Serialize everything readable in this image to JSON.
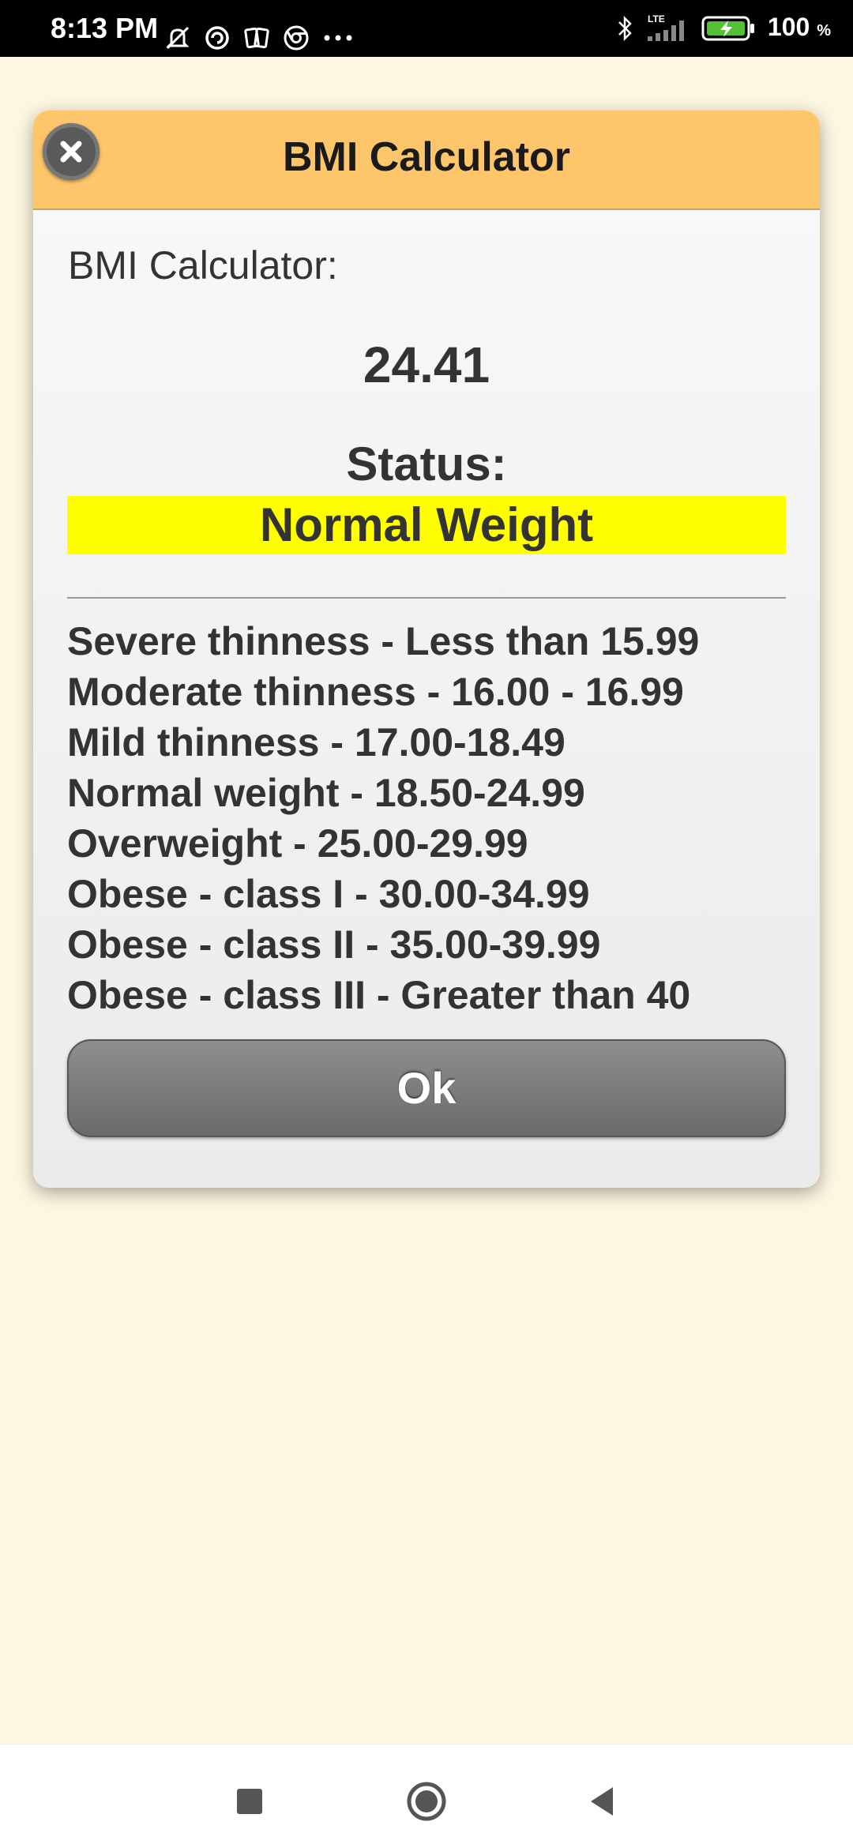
{
  "status_bar": {
    "time": "8:13 PM",
    "left_icons": [
      "muted-bell-icon",
      "vpn-icon",
      "cards-icon",
      "chrome-icon",
      "more-dots-icon"
    ],
    "right_icons": [
      "bluetooth-icon",
      "lte-signal-icon",
      "battery-charging-icon"
    ],
    "network_label": "LTE",
    "battery_percent": "100",
    "battery_unit": "%"
  },
  "dialog": {
    "title": "BMI Calculator",
    "label": "BMI Calculator:",
    "bmi_value": "24.41",
    "status_label": "Status:",
    "status_value": "Normal Weight",
    "status_highlight_color": "#ffff00",
    "header_color": "#fdc66b",
    "ranges": [
      "Severe thinness - Less than 15.99",
      "Moderate thinness - 16.00 - 16.99",
      "Mild thinness - 17.00-18.49",
      "Normal weight - 18.50-24.99",
      "Overweight - 25.00-29.99",
      "Obese - class I - 30.00-34.99",
      "Obese - class II - 35.00-39.99",
      "Obese - class III - Greater than 40"
    ],
    "ok_label": "Ok",
    "close_icon": "close-icon"
  },
  "nav_bar": {
    "buttons": [
      "recent-apps-icon",
      "home-icon",
      "back-icon"
    ]
  },
  "colors": {
    "page_background": "#fdf6e1",
    "button_gray": "#7a7a7a"
  }
}
